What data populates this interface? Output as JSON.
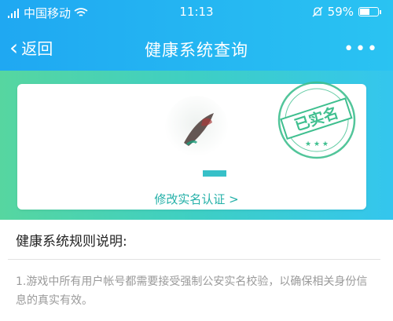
{
  "status_bar": {
    "carrier": "中国移动",
    "time": "11:13",
    "battery_text": "59%",
    "battery_level": 0.59
  },
  "nav": {
    "back_label": "返回",
    "title": "健康系统查询",
    "more_label": "•••"
  },
  "card": {
    "stamp_text": "已实名",
    "link_label": "修改实名认证 >"
  },
  "rules": {
    "title": "健康系统规则说明:",
    "line1": "1.游戏中所有用户帐号都需要接受强制公安实名校验，以确保相关身份信息的真实有效。"
  },
  "colors": {
    "nav_blue": "#1fa8f2",
    "banner_green": "#56d6a0",
    "link_teal": "#24b0a8",
    "stamp_green": "#3fbf8f"
  }
}
